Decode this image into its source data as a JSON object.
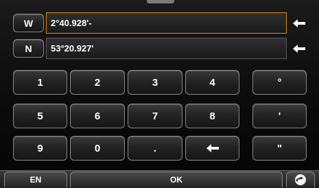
{
  "fields": [
    {
      "direction": "W",
      "value": "2°40.928'-",
      "active": true
    },
    {
      "direction": "N",
      "value": "53°20.927'",
      "active": false
    }
  ],
  "keypad": {
    "row1": [
      "1",
      "2",
      "3",
      "4"
    ],
    "row2": [
      "5",
      "6",
      "7",
      "8"
    ],
    "row3": [
      "9",
      "0",
      "."
    ],
    "symbols": [
      "°",
      "'",
      "\""
    ]
  },
  "bottom": {
    "language": "EN",
    "ok": "OK"
  },
  "colors": {
    "active_border": "#e0891e"
  }
}
